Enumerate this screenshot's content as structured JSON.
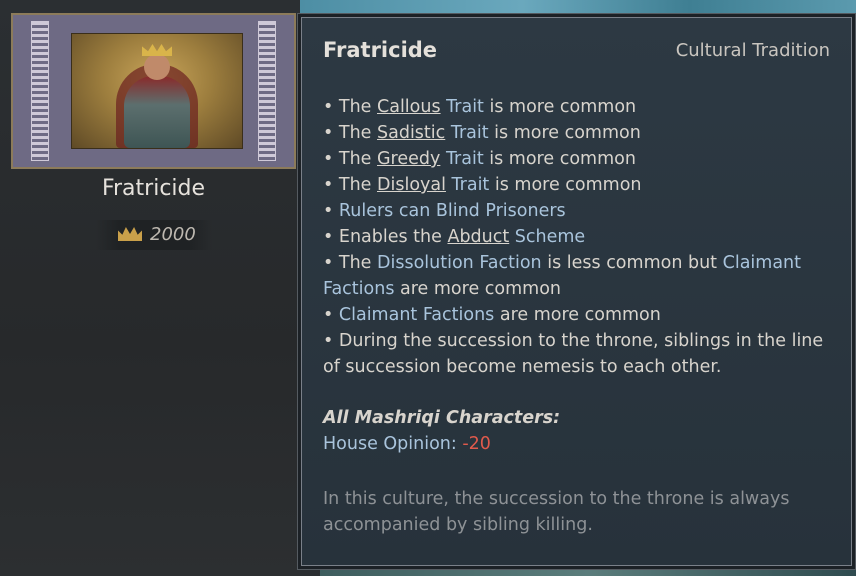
{
  "tradition": {
    "name": "Fratricide",
    "cost": "2000",
    "category": "Cultural Tradition"
  },
  "icons": {
    "portrait": "ruler-on-throne-illustration",
    "cost": "crown-icon"
  },
  "effects": [
    {
      "prefix": "• The ",
      "link": "Callous",
      "mid": " Trait",
      "suffix": " is more common"
    },
    {
      "prefix": "• The ",
      "link": "Sadistic",
      "mid": " Trait",
      "suffix": " is more common"
    },
    {
      "prefix": "• The ",
      "link": "Greedy",
      "mid": " Trait",
      "suffix": " is more common"
    },
    {
      "prefix": "• The ",
      "link": "Disloyal",
      "mid": " Trait",
      "suffix": " is more common"
    }
  ],
  "effect_rulers": {
    "prefix": "• ",
    "blue": "Rulers can Blind Prisoners"
  },
  "effect_abduct": {
    "prefix": "• Enables the ",
    "link": "Abduct",
    "blue": " Scheme"
  },
  "effect_factions": {
    "prefix": "• The ",
    "blue1": "Dissolution Faction",
    "mid": " is less common but ",
    "blue2": "Claimant Factions",
    "suffix": " are more common"
  },
  "effect_claimant": {
    "prefix": "• ",
    "blue": "Claimant Factions",
    "suffix": " are more common"
  },
  "effect_succession": "• During the succession to the throne, siblings in the line of succession become nemesis to each other.",
  "modifier_section": {
    "title": "All Mashriqi Characters:",
    "label": "House Opinion: ",
    "value": "-20"
  },
  "flavor_text": "In this culture, the succession to the throne is always accompanied by sibling killing.",
  "colors": {
    "link_blue": "#a9c4dc",
    "negative_red": "#e05a4c",
    "panel_bg": "#2d3943"
  }
}
